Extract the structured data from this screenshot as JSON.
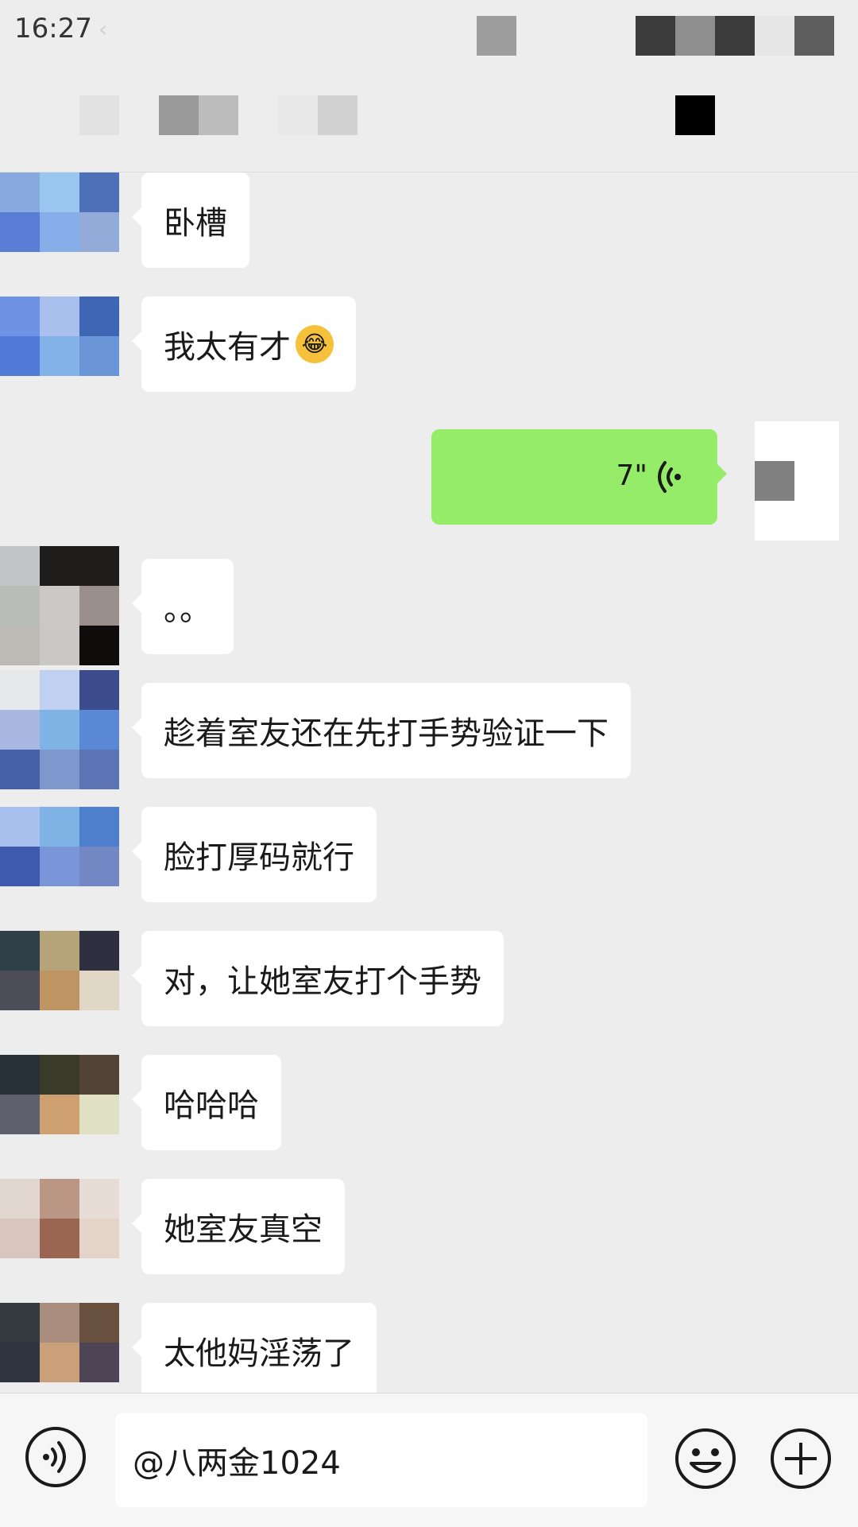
{
  "status_bar": {
    "time": "16:27",
    "chevron": "‹"
  },
  "messages": [
    {
      "text": "卧槽"
    },
    {
      "text": "我太有才",
      "emoji": "😂"
    },
    {
      "voice": {
        "duration": "7\""
      }
    },
    {
      "text": "。。"
    },
    {
      "text": "趁着室友还在先打手势验证一下"
    },
    {
      "text": "脸打厚码就行"
    },
    {
      "text": "对，让她室友打个手势"
    },
    {
      "text": "哈哈哈"
    },
    {
      "text": "她室友真空"
    },
    {
      "text": "太他妈淫荡了"
    }
  ],
  "input": {
    "value": "@八两金1024"
  },
  "icons": {
    "voice_toggle": "voice-input-icon",
    "emoji": "emoji-smiley-icon",
    "plus": "add-more-icon",
    "voice_waves": "voice-waves-icon"
  },
  "colors": {
    "background": "#ededed",
    "sent_bubble": "#95ec69",
    "received_bubble": "#ffffff"
  }
}
